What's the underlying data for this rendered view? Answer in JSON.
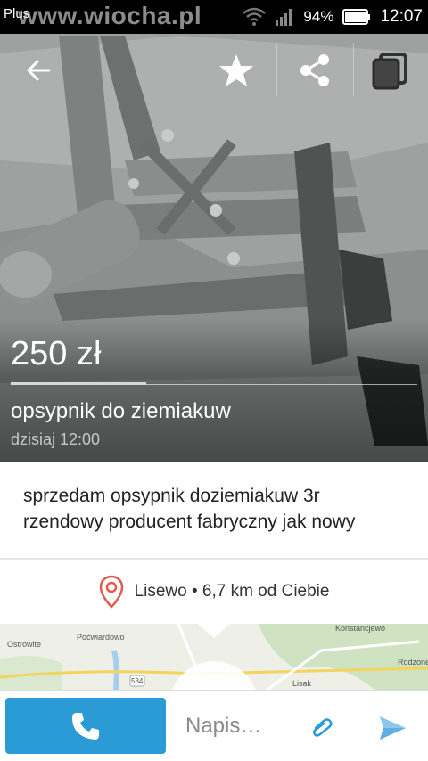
{
  "status_bar": {
    "carrier": "Plus",
    "watermark": "www.wiocha.pl",
    "battery": "94%",
    "time": "12:07"
  },
  "toolbar": {
    "back_icon": "arrow-left-icon",
    "favorite_icon": "star-icon",
    "share_icon": "share-icon",
    "copy_icon": "copy-icon"
  },
  "listing": {
    "price": "250 zł",
    "title": "opsypnik do ziemiakuw",
    "date": "dzisiaj 12:00",
    "description": "sprzedam opsypnik doziemiakuw 3r rzendowy producent fabryczny jak nowy",
    "location": "Lisewo • 6,7 km od Ciebie"
  },
  "map": {
    "places": [
      "Ostrowite",
      "Poćwiardowo",
      "Konstancjewo",
      "Rodzone",
      "Lisak",
      "534"
    ]
  },
  "bottom_bar": {
    "message_placeholder": "Napis…",
    "call_icon": "phone-icon",
    "attach_icon": "paperclip-icon",
    "send_icon": "send-icon"
  },
  "colors": {
    "accent": "#2b9bd6",
    "pin": "#e05a4f",
    "status_bar": "#000000"
  }
}
